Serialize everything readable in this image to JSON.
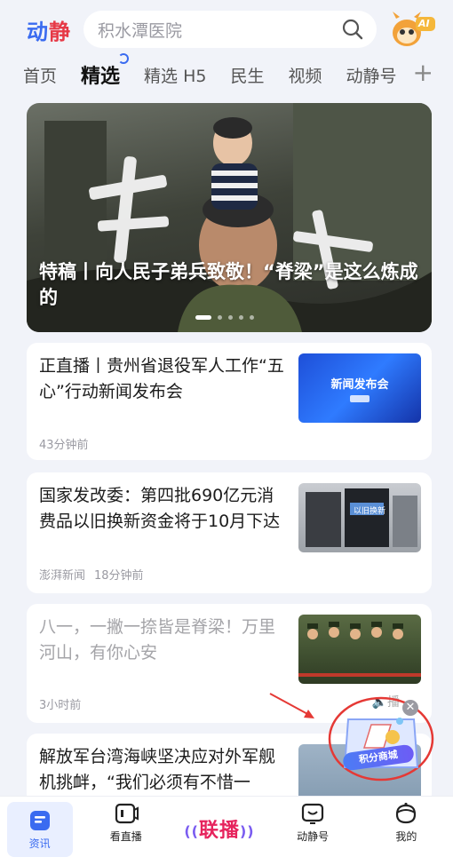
{
  "header": {
    "logo_part1": "动",
    "logo_part2": "静",
    "search_placeholder": "积水潭医院",
    "ai_badge": "AI"
  },
  "tabs": [
    {
      "label": "首页",
      "active": false
    },
    {
      "label": "精选",
      "active": true
    },
    {
      "label": "精选 H5",
      "active": false
    },
    {
      "label": "民生",
      "active": false
    },
    {
      "label": "视频",
      "active": false
    },
    {
      "label": "动静号",
      "active": false
    }
  ],
  "add_tab_icon": "plus-icon",
  "hero": {
    "title": "特稿丨向人民子弟兵致敬！“脊梁”是这么炼成的",
    "slide_count": 5,
    "active_slide": 1
  },
  "feed": [
    {
      "title": "正直播丨贵州省退役军人工作“五心”行动新闻发布会",
      "time": "43分钟前",
      "source": "",
      "thumb_text": "新闻发布会",
      "read": false
    },
    {
      "title": "国家发改委：第四批690亿元消费品以旧换新资金将于10月下达",
      "source": "澎湃新闻",
      "time": "18分钟前",
      "thumb_text": "以旧换新",
      "read": false
    },
    {
      "title": "八一，一撇一捺皆是脊梁！万里河山，有你心安",
      "time": "3小时前",
      "source": "",
      "sound_label": "播",
      "read": true
    },
    {
      "title": "解放军台湾海峡坚决应对外军舰机挑衅，“我们必须有不惜一",
      "time": "",
      "source": "",
      "read": false
    }
  ],
  "float_widget": {
    "label": "积分商城",
    "close_icon": "close-icon"
  },
  "bottom_nav": [
    {
      "label": "资讯",
      "icon": "news-icon",
      "active": true
    },
    {
      "label": "看直播",
      "icon": "live-tv-icon",
      "active": false
    },
    {
      "label": "联播",
      "icon": "broadcast-logo",
      "active": false
    },
    {
      "label": "动静号",
      "icon": "channel-icon",
      "active": false
    },
    {
      "label": "我的",
      "icon": "profile-icon",
      "active": false
    }
  ],
  "colors": {
    "brand_blue": "#3a6bf0",
    "brand_red": "#e63946",
    "live_red": "#e6245d",
    "background": "#f1f3f9"
  }
}
